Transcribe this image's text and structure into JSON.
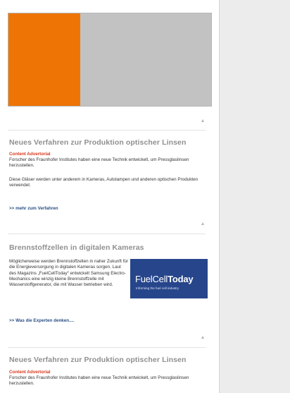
{
  "colors": {
    "banner_orange": "#ee7505",
    "banner_gray": "#c2c2c2",
    "link_blue": "#2b4f86",
    "advertorial_red": "#d9361b",
    "ad_blue": "#26458b"
  },
  "up_icon": "triangle-up-icon",
  "articles": [
    {
      "title": "Neues Verfahren zur Produktion optischer Linsen",
      "label": "Content Advertorial",
      "text1": "Forscher des Fraunhofer Institutes haben eine neue Technik entwickelt, um Pressglaslinsen herzustellen.",
      "text2": "Diese Gläser werden unter anderem in Kameras, Autolampen und anderen optischen Produkten verwendet.",
      "link": ">> mehr zum Verfahren"
    },
    {
      "title": "Brennstoffzellen in digitalen Kameras",
      "text1": "Möglicherweise werden Brennstoffzellen in naher Zukunft für die Energieversorgung in digitalen Kameras sorgen. Laut des Magazins „FuelCellToday“ entwickelt Samsung Electro-Mechanics eine winzig kleine Brennstoffzelle mit Wasserstoffgenerator, die mit Wasser betrieben wird.",
      "link": ">> Was die Experten denken....",
      "ad": {
        "logo_light": "FuelCell",
        "logo_bold": "Today",
        "tagline": "Informing the fuel cell industry"
      }
    },
    {
      "title": "Neues Verfahren zur Produktion optischer Linsen",
      "label": "Content Advertorial",
      "text1": "Forscher des Fraunhofer Institutes haben eine neue Technik entwickelt, um Pressglaslinsen herzustellen."
    }
  ]
}
